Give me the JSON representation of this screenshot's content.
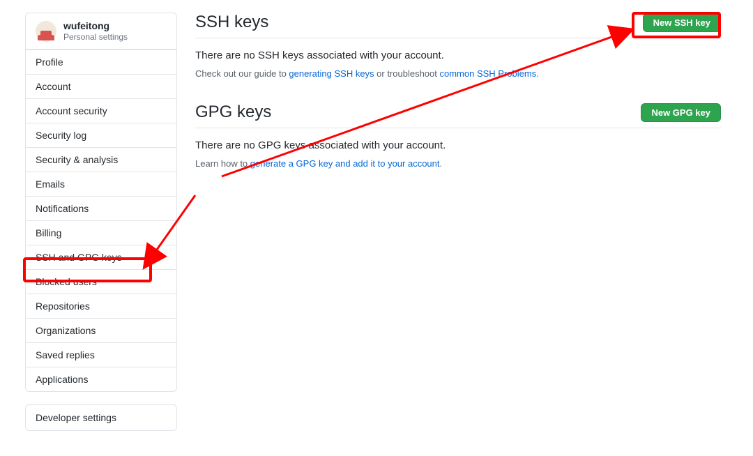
{
  "sidebar": {
    "username": "wufeitong",
    "subtitle": "Personal settings",
    "items": [
      {
        "label": "Profile"
      },
      {
        "label": "Account"
      },
      {
        "label": "Account security"
      },
      {
        "label": "Security log"
      },
      {
        "label": "Security & analysis"
      },
      {
        "label": "Emails"
      },
      {
        "label": "Notifications"
      },
      {
        "label": "Billing"
      },
      {
        "label": "SSH and GPG keys"
      },
      {
        "label": "Blocked users"
      },
      {
        "label": "Repositories"
      },
      {
        "label": "Organizations"
      },
      {
        "label": "Saved replies"
      },
      {
        "label": "Applications"
      }
    ],
    "developer": {
      "label": "Developer settings"
    }
  },
  "ssh": {
    "heading": "SSH keys",
    "button": "New SSH key",
    "empty": "There are no SSH keys associated with your account.",
    "hint_pre": "Check out our guide to ",
    "hint_link1": "generating SSH keys",
    "hint_mid": " or troubleshoot ",
    "hint_link2": "common SSH Problems",
    "hint_post": "."
  },
  "gpg": {
    "heading": "GPG keys",
    "button": "New GPG key",
    "empty": "There are no GPG keys associated with your account.",
    "hint_pre": "Learn how to ",
    "hint_link": "generate a GPG key and add it to your account",
    "hint_post": "."
  },
  "colors": {
    "primary_button": "#2ea44f",
    "link": "#0366d6",
    "border": "#e1e4e8",
    "annotation": "#ff0000"
  }
}
